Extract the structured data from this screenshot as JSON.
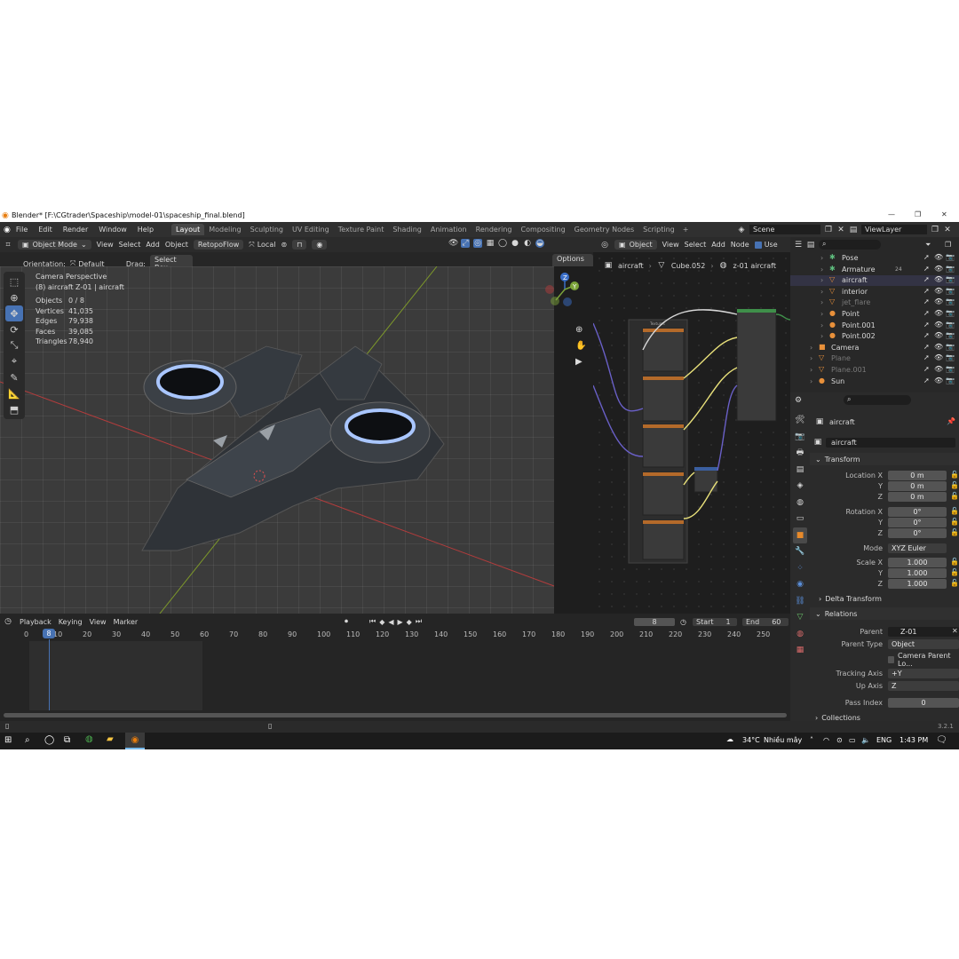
{
  "window": {
    "title": "Blender* [F:\\CGtrader\\Spaceship\\model-01\\spaceship_final.blend]"
  },
  "menu": [
    "File",
    "Edit",
    "Render",
    "Window",
    "Help"
  ],
  "workspaces": [
    "Layout",
    "Modeling",
    "Sculpting",
    "UV Editing",
    "Texture Paint",
    "Shading",
    "Animation",
    "Rendering",
    "Compositing",
    "Geometry Nodes",
    "Scripting"
  ],
  "scene": {
    "label": "Scene",
    "view_layer": "ViewLayer"
  },
  "viewport_header": {
    "mode": "Object Mode",
    "view": "View",
    "select": "Select",
    "add": "Add",
    "object": "Object",
    "retopoflow": "RetopoFlow",
    "transform": "Local",
    "orientation_label": "Orientation:",
    "orientation_value": "Default",
    "drag_label": "Drag:",
    "drag_value": "Select Box",
    "options": "Options"
  },
  "viewport_overlay": {
    "camera": "Camera Perspective",
    "object_name": "(8) aircraft Z-01 | aircraft",
    "stats": [
      {
        "label": "Objects",
        "value": "0 / 8"
      },
      {
        "label": "Vertices",
        "value": "41,035"
      },
      {
        "label": "Edges",
        "value": "79,938"
      },
      {
        "label": "Faces",
        "value": "39,085"
      },
      {
        "label": "Triangles",
        "value": "78,940"
      }
    ]
  },
  "node_editor": {
    "object": "Object",
    "view": "View",
    "select": "Select",
    "add": "Add",
    "node": "Node",
    "use": "Use",
    "breadcrumb": [
      "aircraft",
      "Cube.052",
      "z-01 aircraft"
    ],
    "frame_label": "Textures"
  },
  "outliner": {
    "items": [
      {
        "name": "Pose",
        "dim": false,
        "indent": 3
      },
      {
        "name": "Armature",
        "dim": false,
        "indent": 3
      },
      {
        "name": "aircraft",
        "dim": false,
        "indent": 3
      },
      {
        "name": "interior",
        "dim": false,
        "indent": 3
      },
      {
        "name": "jet_flare",
        "dim": true,
        "indent": 3
      },
      {
        "name": "Point",
        "dim": false,
        "indent": 3
      },
      {
        "name": "Point.001",
        "dim": false,
        "indent": 3
      },
      {
        "name": "Point.002",
        "dim": false,
        "indent": 3
      },
      {
        "name": "Camera",
        "dim": false,
        "indent": 2
      },
      {
        "name": "Plane",
        "dim": true,
        "indent": 2
      },
      {
        "name": "Plane.001",
        "dim": true,
        "indent": 2
      },
      {
        "name": "Sun",
        "dim": false,
        "indent": 2
      }
    ],
    "armature_badge": "24"
  },
  "properties": {
    "object": "aircraft",
    "object_field": "aircraft",
    "transform": "Transform",
    "location": {
      "label": "Location X",
      "x": "0 m",
      "y": "0 m",
      "z": "0 m"
    },
    "rotation": {
      "label": "Rotation X",
      "x": "0°",
      "y": "0°",
      "z": "0°"
    },
    "mode": {
      "label": "Mode",
      "value": "XYZ Euler"
    },
    "scale": {
      "label": "Scale X",
      "x": "1.000",
      "y": "1.000",
      "z": "1.000"
    },
    "axis": {
      "y": "Y",
      "z": "Z"
    },
    "delta_transform": "Delta Transform",
    "relations": "Relations",
    "parent": {
      "label": "Parent",
      "value": "Z-01"
    },
    "parent_type": {
      "label": "Parent Type",
      "value": "Object"
    },
    "camera_parent_lock": "Camera Parent Lo...",
    "tracking_axis": {
      "label": "Tracking Axis",
      "value": "+Y"
    },
    "up_axis": {
      "label": "Up Axis",
      "value": "Z"
    },
    "pass_index": {
      "label": "Pass Index",
      "value": "0"
    },
    "collections": "Collections",
    "version": "3.2.1"
  },
  "timeline": {
    "playback": "Playback",
    "keying": "Keying",
    "view": "View",
    "marker": "Marker",
    "current_frame": "8",
    "start_label": "Start",
    "start": "1",
    "end_label": "End",
    "end": "60",
    "ticks": [
      "0",
      "10",
      "20",
      "30",
      "40",
      "50",
      "60",
      "70",
      "80",
      "90",
      "100",
      "110",
      "120",
      "130",
      "140",
      "150",
      "160",
      "170",
      "180",
      "190",
      "200",
      "210",
      "220",
      "230",
      "240",
      "250"
    ]
  },
  "taskbar": {
    "weather_temp": "34°C",
    "weather_text": "Nhiều mây",
    "lang": "ENG",
    "time": "1:43 PM"
  }
}
